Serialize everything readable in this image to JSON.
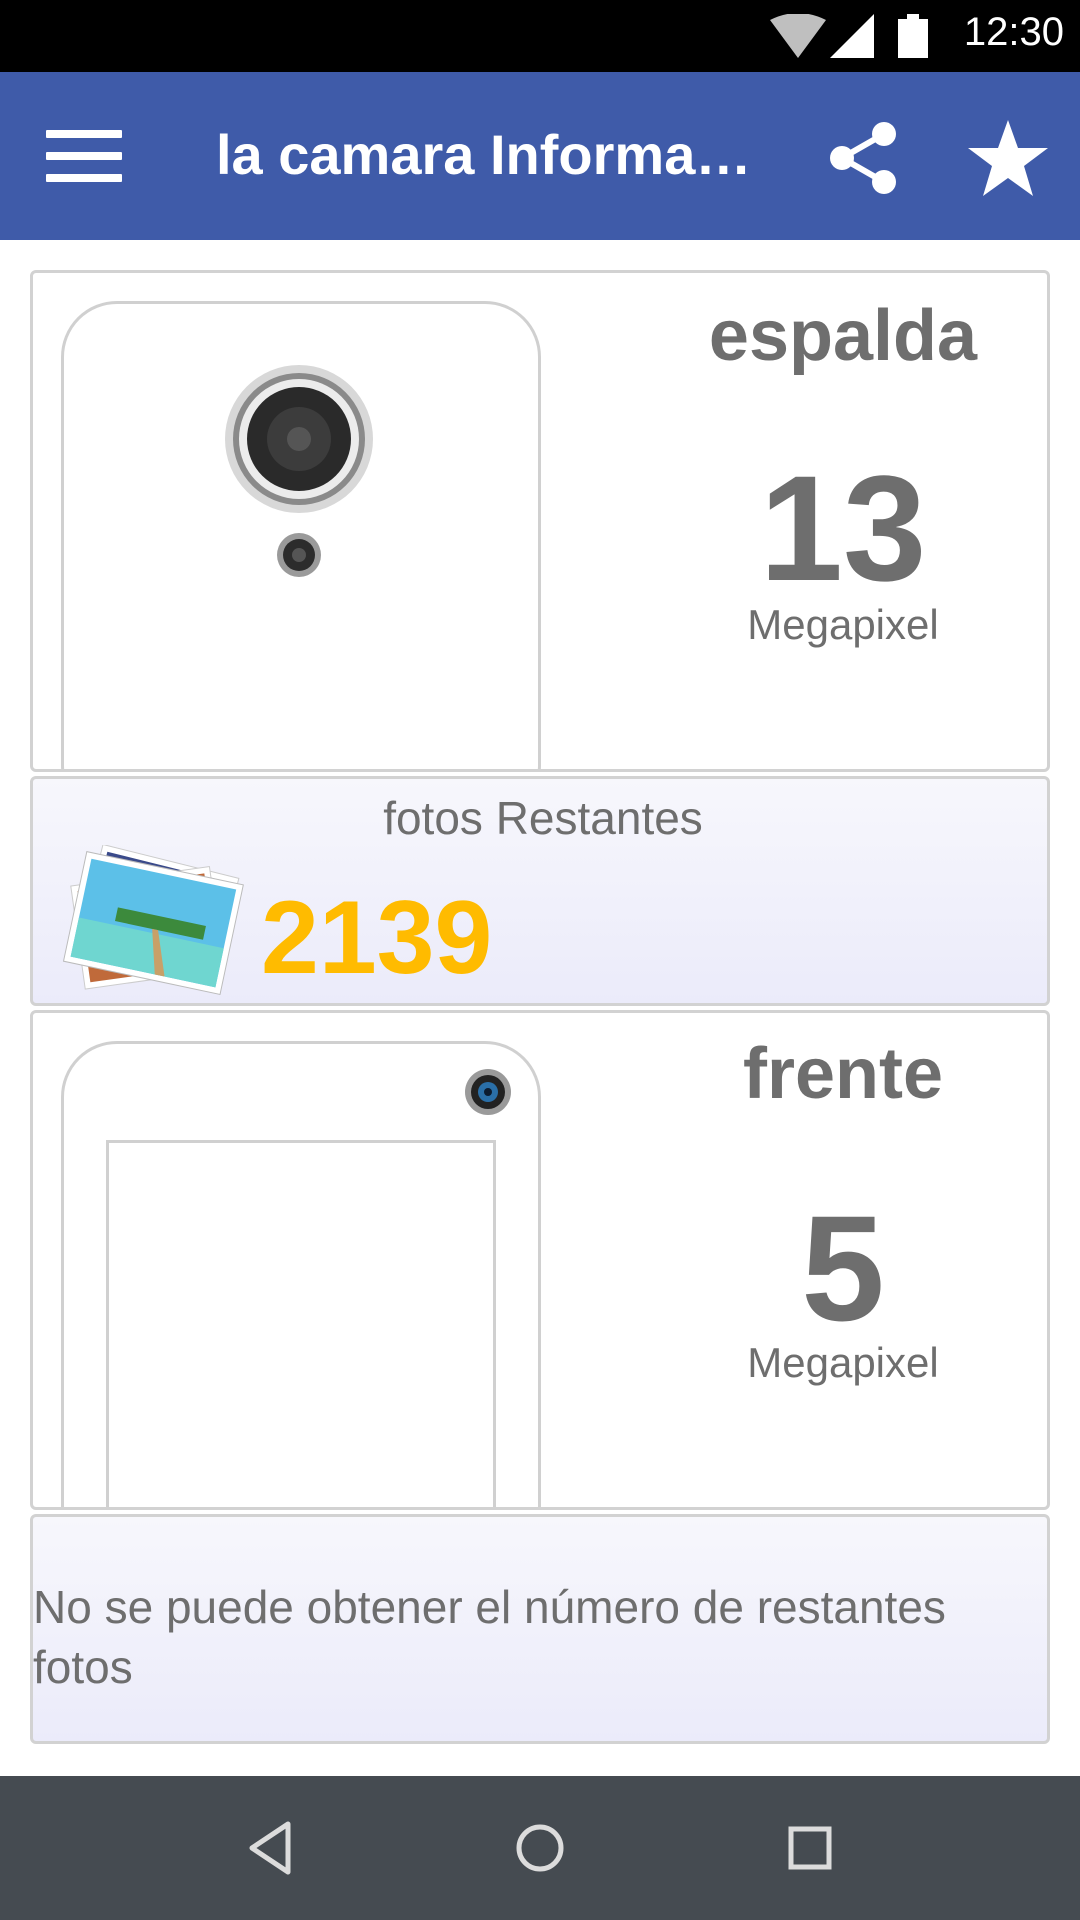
{
  "status_bar": {
    "time": "12:30",
    "icons": [
      "wifi-icon",
      "signal-icon",
      "battery-icon"
    ]
  },
  "app_bar": {
    "title": "la camara Informa…",
    "background_color": "#3f5ba9",
    "icons": [
      "menu-icon",
      "share-icon",
      "star-icon"
    ]
  },
  "back_camera": {
    "label": "espalda",
    "megapixels": "13",
    "unit": "Megapixel"
  },
  "remaining_photos": {
    "heading": "fotos Restantes",
    "count": "2139",
    "count_color": "#ffbb00",
    "icon": "photos-icon"
  },
  "front_camera": {
    "label": "frente",
    "megapixels": "5",
    "unit": "Megapixel"
  },
  "front_remaining": {
    "message": "No se puede obtener el número de restantes fotos"
  },
  "nav_bar": {
    "icons": [
      "back-icon",
      "home-icon",
      "recents-icon"
    ]
  }
}
